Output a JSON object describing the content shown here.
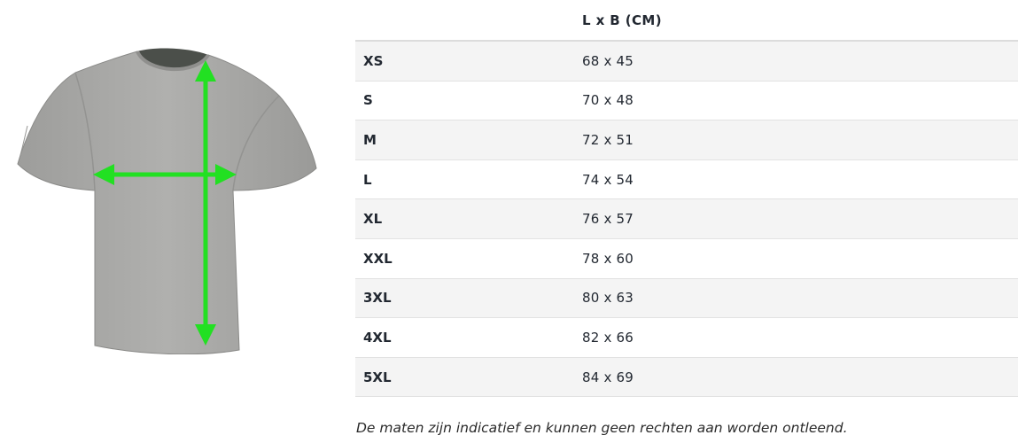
{
  "table": {
    "header": [
      "",
      "L x B (CM)"
    ],
    "rows": [
      {
        "size": "XS",
        "dimensions": "68 x 45"
      },
      {
        "size": "S",
        "dimensions": "70 x 48"
      },
      {
        "size": "M",
        "dimensions": "72 x 51"
      },
      {
        "size": "L",
        "dimensions": "74 x 54"
      },
      {
        "size": "XL",
        "dimensions": "76 x 57"
      },
      {
        "size": "XXL",
        "dimensions": "78 x 60"
      },
      {
        "size": "3XL",
        "dimensions": "80 x 63"
      },
      {
        "size": "4XL",
        "dimensions": "82 x 66"
      },
      {
        "size": "5XL",
        "dimensions": "84 x 69"
      }
    ]
  },
  "disclaimer": "De maten zijn indicatief en kunnen geen rechten aan worden ontleend.",
  "figure": {
    "shirt_color": "#a9a9a7",
    "arrow_color": "#22e022"
  }
}
